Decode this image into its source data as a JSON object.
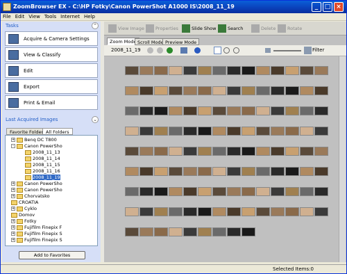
{
  "window": {
    "title": "ZoomBrowser EX  -  C:\\HP Fotky\\Canon PowerShot A1000 IS\\2008_11_19"
  },
  "menu": [
    "File",
    "Edit",
    "View",
    "Tools",
    "Internet",
    "Help"
  ],
  "tasks": {
    "header": "Tasks",
    "items": [
      {
        "label": "Acquire & Camera Settings"
      },
      {
        "label": "View & Classify"
      },
      {
        "label": "Edit"
      },
      {
        "label": "Export"
      },
      {
        "label": "Print & Email"
      }
    ]
  },
  "last_acquired": {
    "header": "Last Acquired Images"
  },
  "folder_tabs": [
    "Favorite Folders",
    "All Folders"
  ],
  "tree": [
    {
      "label": "Benq DC T800",
      "level": 1,
      "exp": "+"
    },
    {
      "label": "Canon PowerSho",
      "level": 1,
      "exp": "-"
    },
    {
      "label": "2008_11_13",
      "level": 2
    },
    {
      "label": "2008_11_14",
      "level": 2
    },
    {
      "label": "2008_11_15",
      "level": 2
    },
    {
      "label": "2008_11_16",
      "level": 2
    },
    {
      "label": "2008_11_19",
      "level": 2
    },
    {
      "label": "Canon PowerSho",
      "level": 1,
      "exp": "+"
    },
    {
      "label": "Canon PowerSho",
      "level": 1,
      "exp": "+"
    },
    {
      "label": "Chorvatsko",
      "level": 1,
      "exp": "+"
    },
    {
      "label": "CROATIA",
      "level": 1
    },
    {
      "label": "Cyklo",
      "level": 1,
      "exp": "+"
    },
    {
      "label": "Domov",
      "level": 1
    },
    {
      "label": "Fotky",
      "level": 1,
      "exp": "+"
    },
    {
      "label": "Fujifilm Finepix F",
      "level": 1,
      "exp": "+"
    },
    {
      "label": "Fujifilm Finepix S",
      "level": 1,
      "exp": "+"
    },
    {
      "label": "Fujifilm Finepix S",
      "level": 1,
      "exp": "+"
    }
  ],
  "add_favorites": "Add to Favorites",
  "toolbar": [
    {
      "label": "View Image",
      "enabled": false
    },
    {
      "label": "Properties",
      "enabled": false
    },
    {
      "label": "Slide Show",
      "enabled": true
    },
    {
      "label": "Search",
      "enabled": true
    },
    {
      "label": "Delete",
      "enabled": false
    },
    {
      "label": "Rotate",
      "enabled": false
    }
  ],
  "mode_tabs": [
    "Zoom Mode",
    "Scroll Mode",
    "Preview Mode"
  ],
  "current_folder": "2008_11_19",
  "filter_label": "Filter",
  "status": "Selected Items:0",
  "colors": {
    "accent": "#0a3fb8",
    "tree_selected": "#316ac5"
  }
}
